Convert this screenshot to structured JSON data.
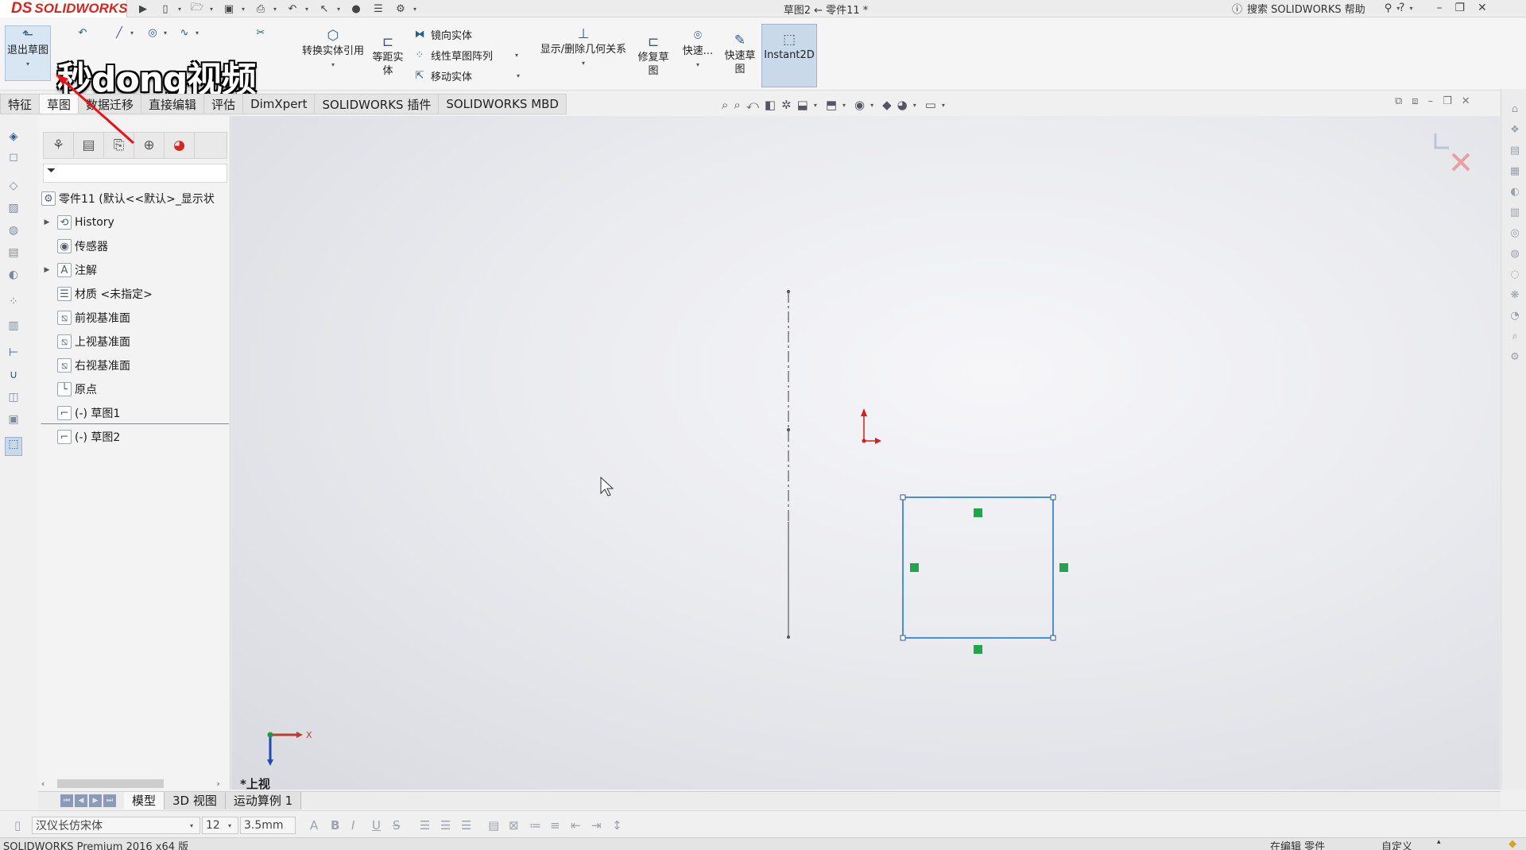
{
  "app": {
    "logo_text": "SOLIDWORKS",
    "logo_prefix": "DS",
    "document_title": "草图2 ← 零件11 *",
    "help_search": "搜索 SOLIDWORKS 帮助"
  },
  "window_controls": {
    "help": "?",
    "minimize": "–",
    "restore": "❐",
    "close": "✕"
  },
  "ribbon": {
    "exit_sketch": "退出草图",
    "convert_entities": "转换实体引用",
    "offset_entities": "等距实\n体",
    "mirror_entities": "镜向实体",
    "linear_pattern": "线性草图阵列",
    "move_entities": "移动实体",
    "display_delete_relations": "显示/删除几何关系",
    "repair_sketch": "修复草\n图",
    "quick_snaps": "快速...",
    "rapid_sketch": "快速草\n图",
    "instant2d": "Instant2D"
  },
  "watermark": "秒dong视频",
  "tabs": [
    {
      "label": "特征"
    },
    {
      "label": "草图"
    },
    {
      "label": "数据迁移"
    },
    {
      "label": "直接编辑"
    },
    {
      "label": "评估"
    },
    {
      "label": "DimXpert"
    },
    {
      "label": "SOLIDWORKS 插件"
    },
    {
      "label": "SOLIDWORKS MBD"
    }
  ],
  "feature_tree": {
    "root": "零件11  (默认<<默认>_显示状",
    "nodes": [
      {
        "label": "History",
        "icon": "history-icon"
      },
      {
        "label": "传感器",
        "icon": "sensor-icon"
      },
      {
        "label": "注解",
        "icon": "annotation-icon"
      },
      {
        "label": "材质 <未指定>",
        "icon": "material-icon"
      },
      {
        "label": "前视基准面",
        "icon": "plane-icon"
      },
      {
        "label": "上视基准面",
        "icon": "plane-icon"
      },
      {
        "label": "右视基准面",
        "icon": "plane-icon"
      },
      {
        "label": "原点",
        "icon": "origin-icon"
      },
      {
        "label": "(-) 草图1",
        "icon": "sketch-icon"
      },
      {
        "label": "(-) 草图2",
        "icon": "sketch-icon"
      }
    ]
  },
  "viewport": {
    "view_name": "*上视",
    "axis_x": "X"
  },
  "bottom_tabs": [
    {
      "label": "模型"
    },
    {
      "label": "3D 视图"
    },
    {
      "label": "运动算例 1"
    }
  ],
  "format_bar": {
    "font": "汉仪长仿宋体",
    "size": "12",
    "height": "3.5mm"
  },
  "status": {
    "product": "SOLIDWORKS Premium 2016 x64 版",
    "mode": "在编辑 零件",
    "units": "自定义"
  },
  "colors": {
    "sketch_blue": "#4b8fd8",
    "handle_green": "#1fa64a",
    "origin_red": "#d42020",
    "brand_red": "#d9251d"
  }
}
